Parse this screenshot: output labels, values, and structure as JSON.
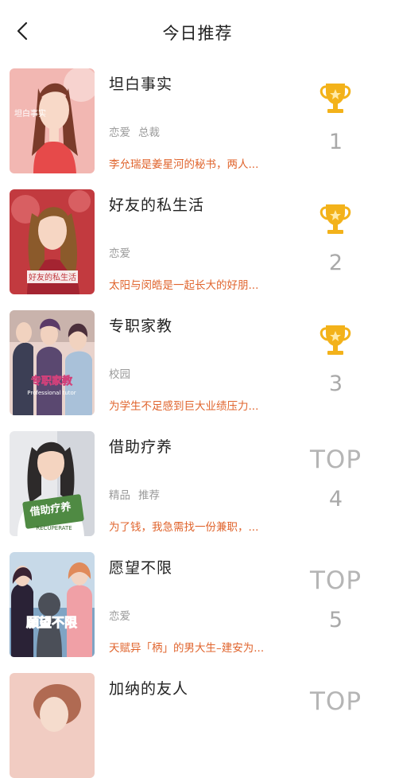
{
  "header": {
    "title": "今日推荐",
    "back_icon": "chevron-left-icon"
  },
  "colors": {
    "accent": "#e0642d",
    "muted": "#9a9a9a",
    "trophy": "#f3b21a"
  },
  "items": [
    {
      "title": "坦白事实",
      "tags": [
        "恋爱",
        "总裁"
      ],
      "desc": "李允瑞是姜星河的秘书，两人...",
      "rank_prefix": "",
      "rank": "1",
      "rank_style": "trophy",
      "cover_text": "坦白事实"
    },
    {
      "title": "好友的私生活",
      "tags": [
        "恋爱"
      ],
      "desc": "太阳与闵皓是一起长大的好朋...",
      "rank_prefix": "",
      "rank": "2",
      "rank_style": "trophy",
      "cover_text": "好友的私生活"
    },
    {
      "title": "专职家教",
      "tags": [
        "校园"
      ],
      "desc": "为学生不足感到巨大业绩压力...",
      "rank_prefix": "",
      "rank": "3",
      "rank_style": "trophy",
      "cover_text": "专职家教",
      "cover_sub": "Professional tutor"
    },
    {
      "title": "借助疗养",
      "tags": [
        "精品",
        "推荐"
      ],
      "desc": "为了钱，我急需找一份兼职，...",
      "rank_prefix": "TOP",
      "rank": "4",
      "rank_style": "top",
      "cover_text": "借助疗养",
      "cover_sub": "RECUPERATE"
    },
    {
      "title": "愿望不限",
      "tags": [
        "恋爱"
      ],
      "desc": "天赋异「柄」的男大生–建安为...",
      "rank_prefix": "TOP",
      "rank": "5",
      "rank_style": "top",
      "cover_text": "願望不限"
    },
    {
      "title": "加纳的友人",
      "tags": [],
      "desc": "",
      "rank_prefix": "TOP",
      "rank": "",
      "rank_style": "top",
      "cover_text": ""
    }
  ]
}
